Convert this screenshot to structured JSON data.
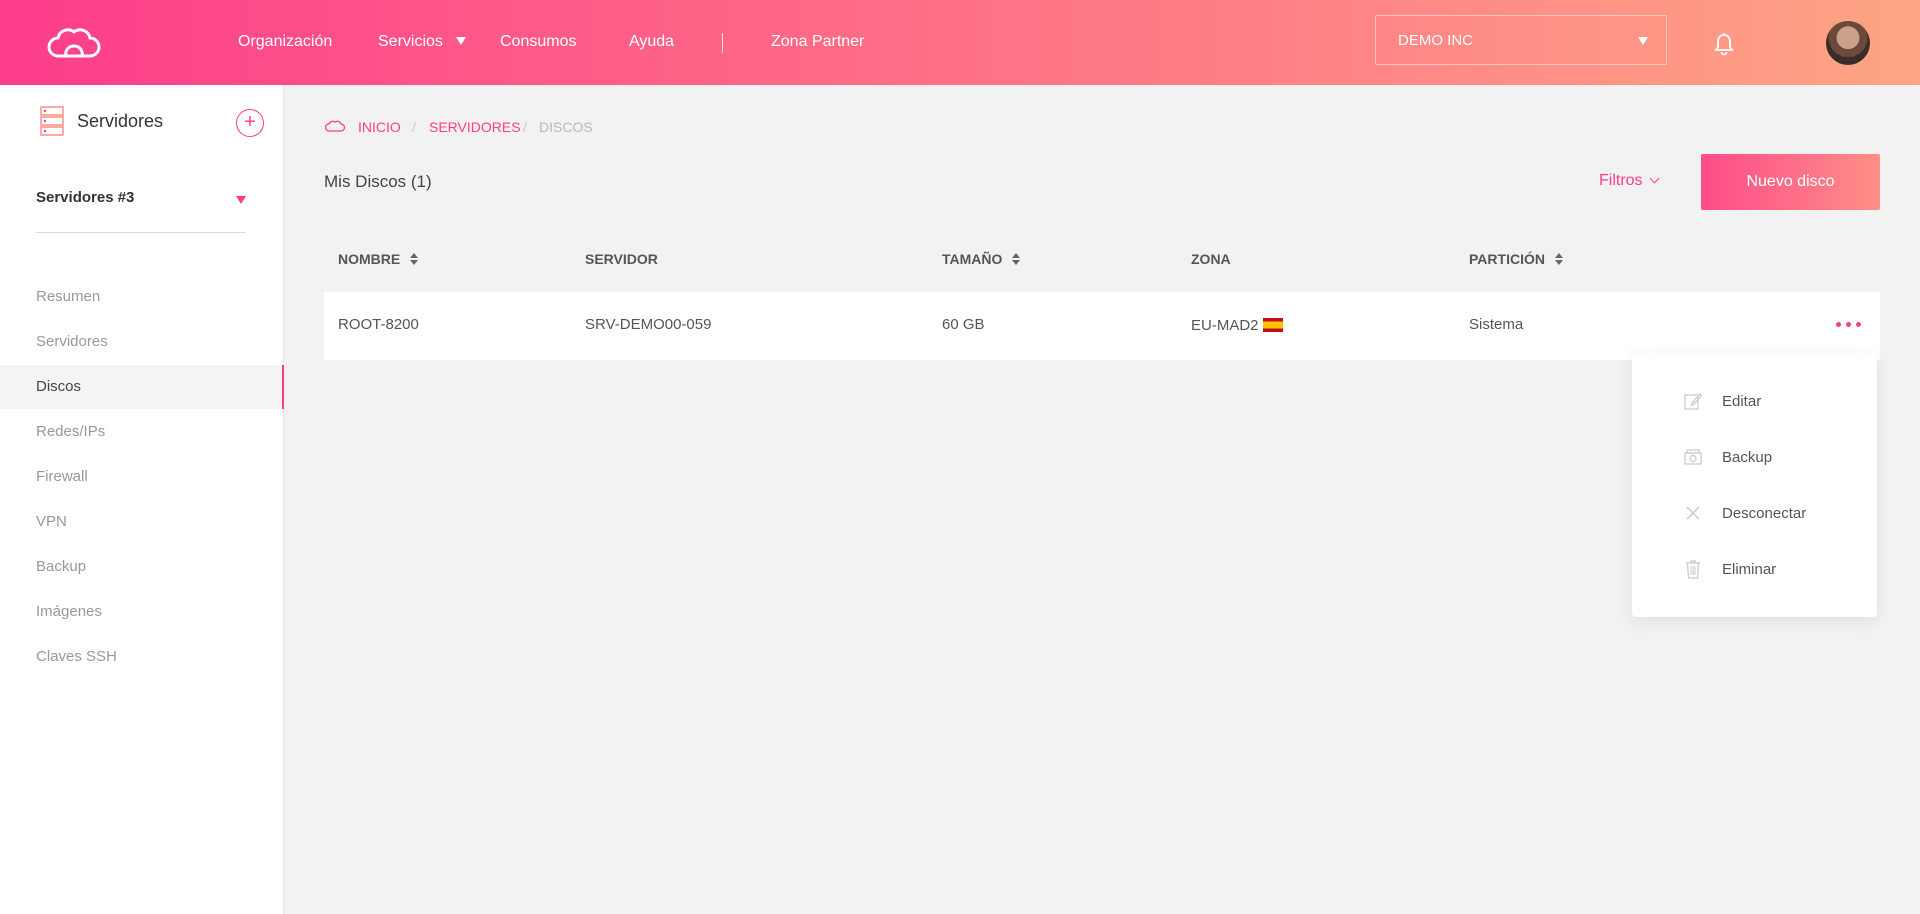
{
  "header": {
    "nav": [
      "Organización",
      "Servicios",
      "Consumos",
      "Ayuda",
      "Zona Partner"
    ],
    "org_select": "DEMO INC"
  },
  "sidebar": {
    "title": "Servidores",
    "select": "Servidores #3",
    "items": [
      "Resumen",
      "Servidores",
      "Discos",
      "Redes/IPs",
      "Firewall",
      "VPN",
      "Backup",
      "Imágenes",
      "Claves SSH"
    ],
    "active": "Discos"
  },
  "breadcrumb": {
    "items": [
      "INICIO",
      "SERVIDORES",
      "DISCOS"
    ],
    "separator": "/"
  },
  "main": {
    "title": "Mis Discos (1)",
    "filters": "Filtros",
    "new_button": "Nuevo disco"
  },
  "table": {
    "headers": [
      "NOMBRE",
      "SERVIDOR",
      "TAMAÑO",
      "ZONA",
      "PARTICIÓN"
    ],
    "rows": [
      {
        "nombre": "ROOT-8200",
        "servidor": "SRV-DEMO00-059",
        "tamano": "60 GB",
        "zona": "EU-MAD2",
        "particion": "Sistema"
      }
    ]
  },
  "menu": {
    "items": [
      "Editar",
      "Backup",
      "Desconectar",
      "Eliminar"
    ]
  },
  "colors": {
    "accent": "#fd3d8b",
    "gradient_end": "#fea584"
  },
  "icons": {
    "logo": "cloud-logo-icon",
    "bell": "bell-icon",
    "add": "plus-circle-icon",
    "more": "ellipsis-icon",
    "flag": "spain-flag-icon"
  }
}
